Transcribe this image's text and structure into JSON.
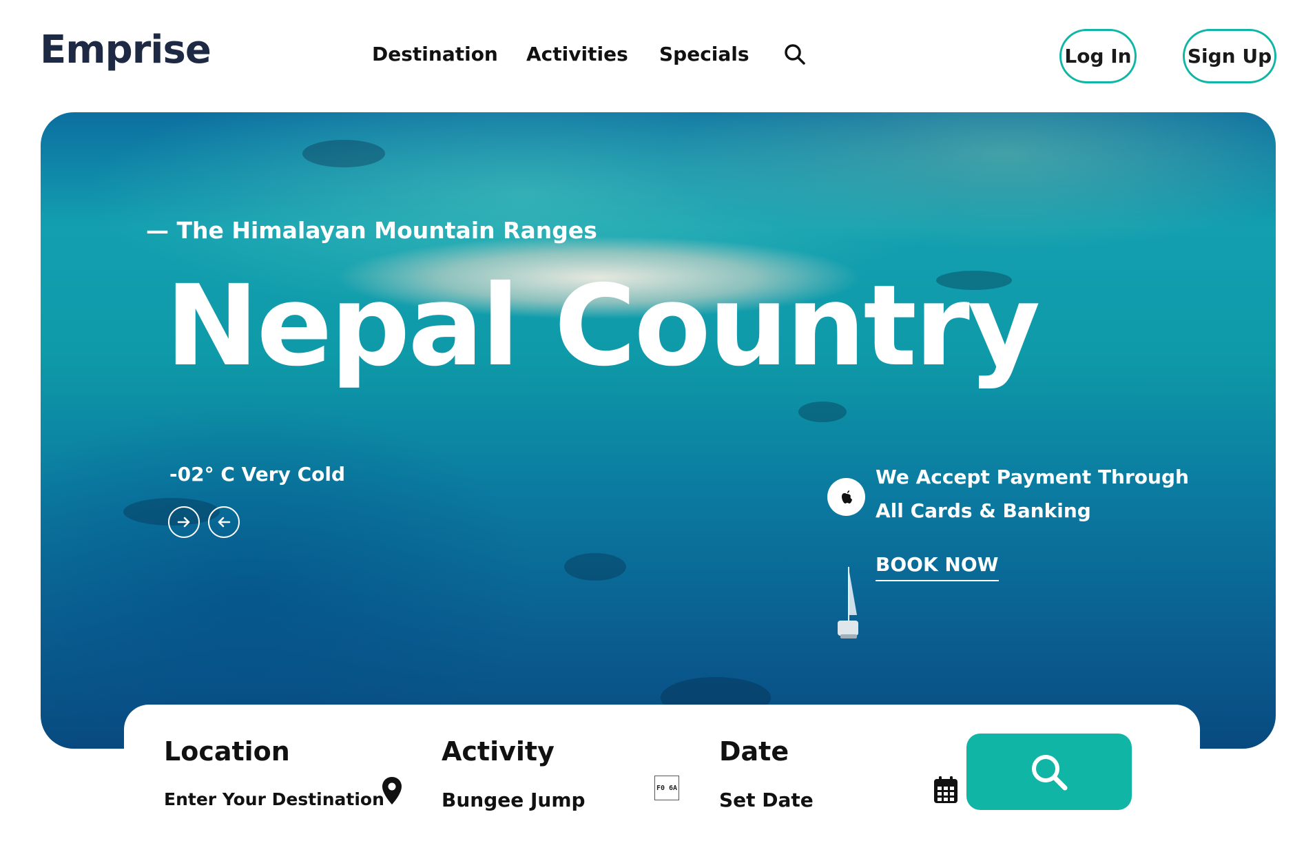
{
  "brand": {
    "logo": "Emprise"
  },
  "nav": {
    "items": [
      "Destination",
      "Activities",
      "Specials"
    ],
    "search_icon": "search-icon"
  },
  "auth": {
    "login_label": "Log In",
    "signup_label": "Sign Up"
  },
  "hero": {
    "eyebrow": "— The Himalayan Mountain Ranges",
    "headline": "Nepal Country",
    "temperature": "-02° C Very Cold",
    "payment_line1": "We Accept Payment Through",
    "payment_line2": "All Cards & Banking",
    "book_label": "BOOK NOW",
    "payment_icon": "apple-icon",
    "nav_icons": [
      "arrow-right-icon",
      "arrow-left-icon"
    ]
  },
  "booking": {
    "location": {
      "label": "Location",
      "value": "Enter Your Destination",
      "icon": "map-pin-icon"
    },
    "activity": {
      "label": "Activity",
      "value": "Bungee Jump",
      "icon_glyph": "F0 6A"
    },
    "date": {
      "label": "Date",
      "value": "Set Date",
      "icon": "calendar-icon"
    },
    "search_icon": "search-icon"
  },
  "colors": {
    "accent": "#10b5a6",
    "logo": "#1e2a44",
    "text": "#111111"
  }
}
